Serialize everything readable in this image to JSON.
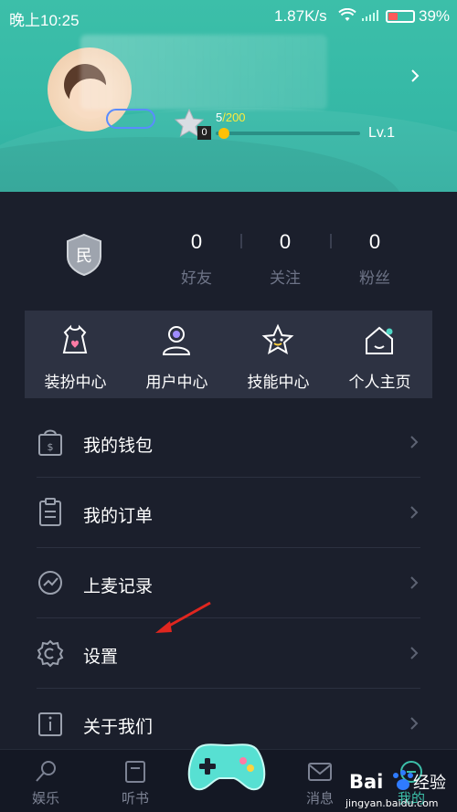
{
  "status_bar": {
    "time": "晚上10:25",
    "speed": "1.87K/s",
    "battery": "39%"
  },
  "profile": {
    "level_progress": "5",
    "level_max": "/200",
    "level_label": "Lv.1",
    "star_count": "0",
    "progress_fraction": 0.025
  },
  "stats": [
    {
      "value": "0",
      "label": "好友"
    },
    {
      "value": "0",
      "label": "关注"
    },
    {
      "value": "0",
      "label": "粉丝"
    }
  ],
  "shield_char": "民",
  "quick_grid": [
    {
      "label": "装扮中心",
      "icon": "dress-icon"
    },
    {
      "label": "用户中心",
      "icon": "user-icon"
    },
    {
      "label": "技能中心",
      "icon": "star-face-icon"
    },
    {
      "label": "个人主页",
      "icon": "home-icon"
    }
  ],
  "menu": [
    {
      "label": "我的钱包",
      "icon": "wallet-icon"
    },
    {
      "label": "我的订单",
      "icon": "order-icon"
    },
    {
      "label": "上麦记录",
      "icon": "record-icon"
    },
    {
      "label": "设置",
      "icon": "settings-icon"
    },
    {
      "label": "关于我们",
      "icon": "info-icon"
    }
  ],
  "tabbar": [
    {
      "label": "娱乐",
      "icon": "entertainment-icon"
    },
    {
      "label": "听书",
      "icon": "book-icon"
    },
    {
      "label": "消息",
      "icon": "message-icon"
    },
    {
      "label": "我的",
      "icon": "me-icon"
    }
  ],
  "watermark": {
    "brand": "Bai",
    "brand2": "经验",
    "url": "jingyan.baidu.com"
  },
  "colors": {
    "header_teal": "#3cbfa9",
    "body_dark": "#1b1f2c",
    "grid_bg": "#2d3242",
    "accent_yellow": "#ffc107",
    "annotation_red": "#e0261f"
  }
}
